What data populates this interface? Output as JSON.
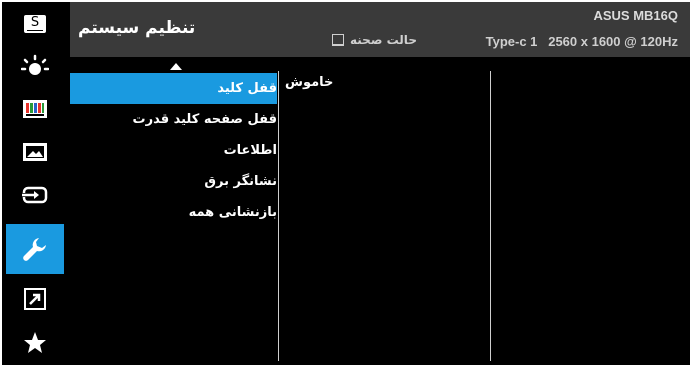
{
  "header": {
    "title": "تنظیم سیستم",
    "brand": "ASUS MB16Q",
    "mode": "Type-c 1   2560 x 1600 @ 120Hz",
    "scene_label": "حالت صحنه"
  },
  "sidebar": {
    "items": [
      {
        "icon": "splendid-icon",
        "active": false
      },
      {
        "icon": "brightness-icon",
        "active": false
      },
      {
        "icon": "color-icon",
        "active": false
      },
      {
        "icon": "image-icon",
        "active": false
      },
      {
        "icon": "input-select-icon",
        "active": false
      },
      {
        "icon": "system-setup-icon",
        "active": true
      },
      {
        "icon": "shortcut-icon",
        "active": false
      },
      {
        "icon": "favorite-icon",
        "active": false
      }
    ],
    "splendid_letter": "S"
  },
  "menu": {
    "items": [
      {
        "label": "قفل کلید",
        "active": true
      },
      {
        "label": "قفل صفحه کلید قدرت",
        "active": false
      },
      {
        "label": "اطلاعات",
        "active": false
      },
      {
        "label": "نشانگر برق",
        "active": false
      },
      {
        "label": "بازنشانی همه",
        "active": false
      }
    ]
  },
  "options": {
    "value": "خاموش"
  },
  "colors": {
    "accent": "#1a9ae0",
    "header_bg": "#3a3a3a",
    "panel_bg": "#000000"
  }
}
